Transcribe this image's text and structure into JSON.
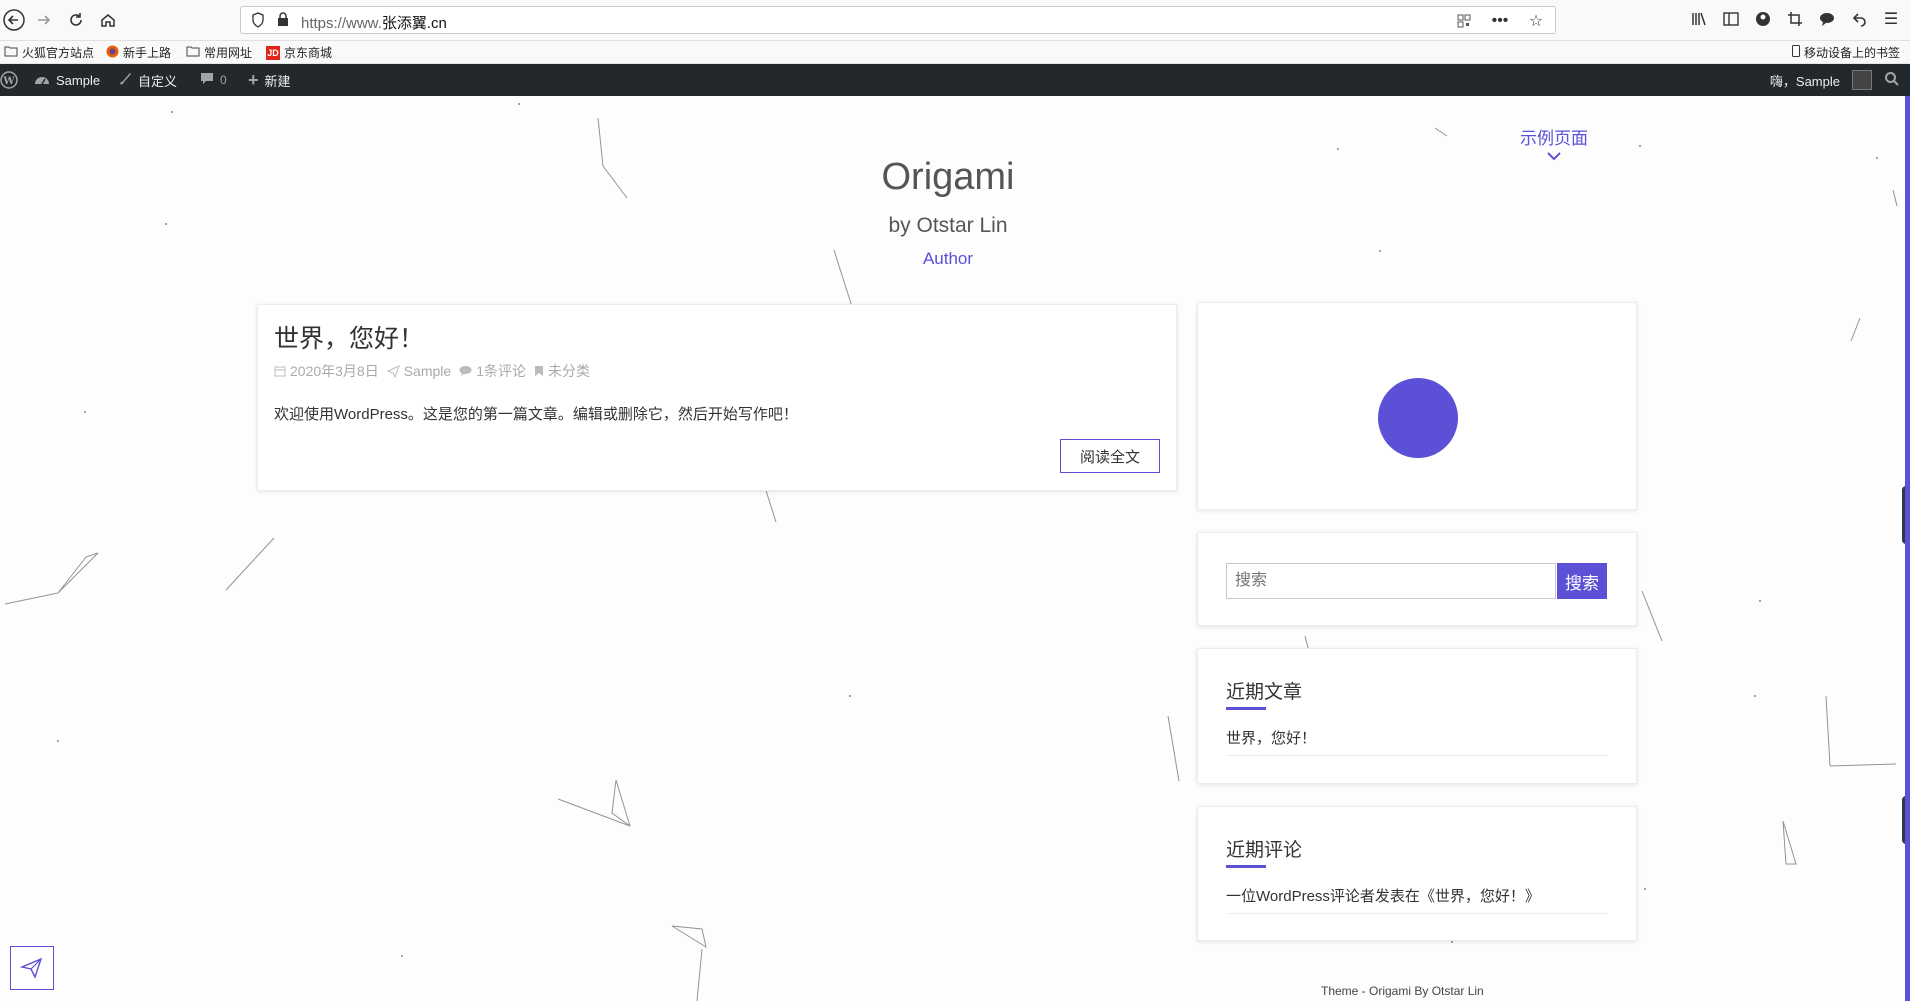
{
  "browser": {
    "url_prefix": "https://www.",
    "url_domain": "张添翼.cn",
    "bookmarks": [
      "火狐官方站点",
      "新手上路",
      "常用网址",
      "京东商城"
    ],
    "mobile_bookmarks": "移动设备上的书签"
  },
  "admin_bar": {
    "site_name": "Sample",
    "customize": "自定义",
    "comments_count": "0",
    "new_label": "新建",
    "greeting": "嗨，Sample"
  },
  "header": {
    "nav_link": "示例页面",
    "site_title": "Origami",
    "subtitle": "by Otstar Lin",
    "role": "Author"
  },
  "post": {
    "title": "世界，您好！",
    "date": "2020年3月8日",
    "author": "Sample",
    "comments": "1条评论",
    "category": "未分类",
    "excerpt": "欢迎使用WordPress。这是您的第一篇文章。编辑或删除它，然后开始写作吧！",
    "read_more": "阅读全文"
  },
  "sidebar": {
    "search_placeholder": "搜索",
    "search_button": "搜索",
    "recent_posts_title": "近期文章",
    "recent_posts": [
      "世界，您好！"
    ],
    "recent_comments_title": "近期评论",
    "recent_comments": [
      "一位WordPress评论者发表在《世界，您好！》"
    ]
  },
  "footer": {
    "credit": "Theme - Origami By Otstar Lin"
  },
  "colors": {
    "accent": "#5b50d6",
    "admin_bar": "#23282d"
  }
}
